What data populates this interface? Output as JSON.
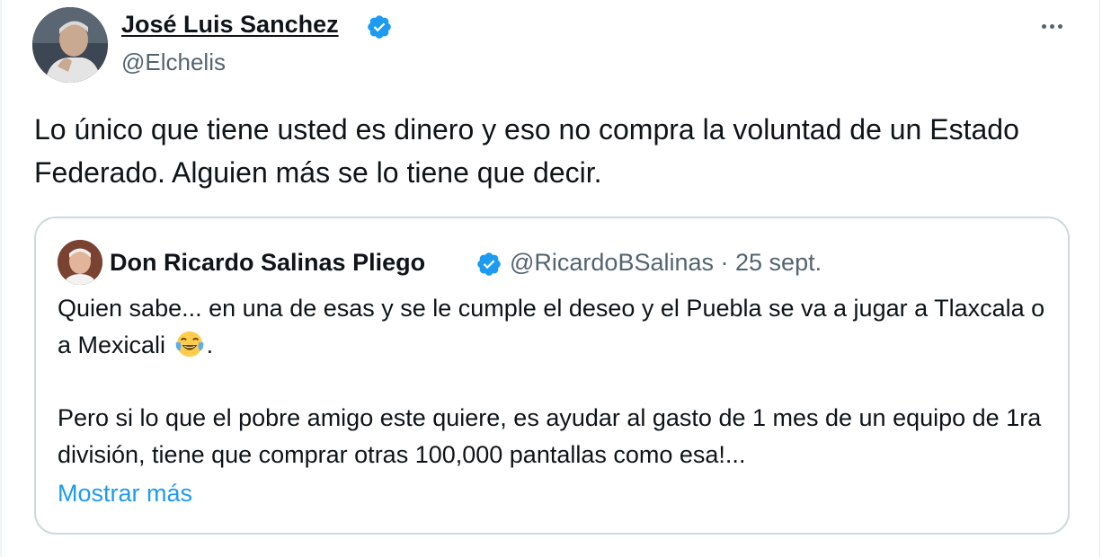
{
  "tweet": {
    "author_name": "José Luis Sanchez",
    "author_handle": "@Elchelis",
    "body": "Lo único que tiene usted es dinero y eso no compra la voluntad de un Estado Federado. Alguien más se lo tiene que decir."
  },
  "quoted": {
    "author_name": "Don Ricardo Salinas Pliego",
    "handle": "@RicardoBSalinas",
    "separator": " · ",
    "date": "25 sept.",
    "paragraph1_before_emoji": "Quien sabe... en una de esas y se le cumple el deseo y el Puebla se va a jugar a Tlaxcala o a Mexicali",
    "paragraph1_after_emoji": ".",
    "emoji": "face-with-tears-of-joy",
    "paragraph2": "Pero si lo que el pobre amigo este quiere, es ayudar al gasto de 1 mes de un equipo de 1ra división, tiene que comprar otras 100,000 pantallas como esa!...",
    "show_more": "Mostrar más"
  },
  "colors": {
    "verified": "#1d9bf0",
    "link": "#1d9bf0",
    "secondary_text": "#536471",
    "border": "#cfd9de"
  }
}
